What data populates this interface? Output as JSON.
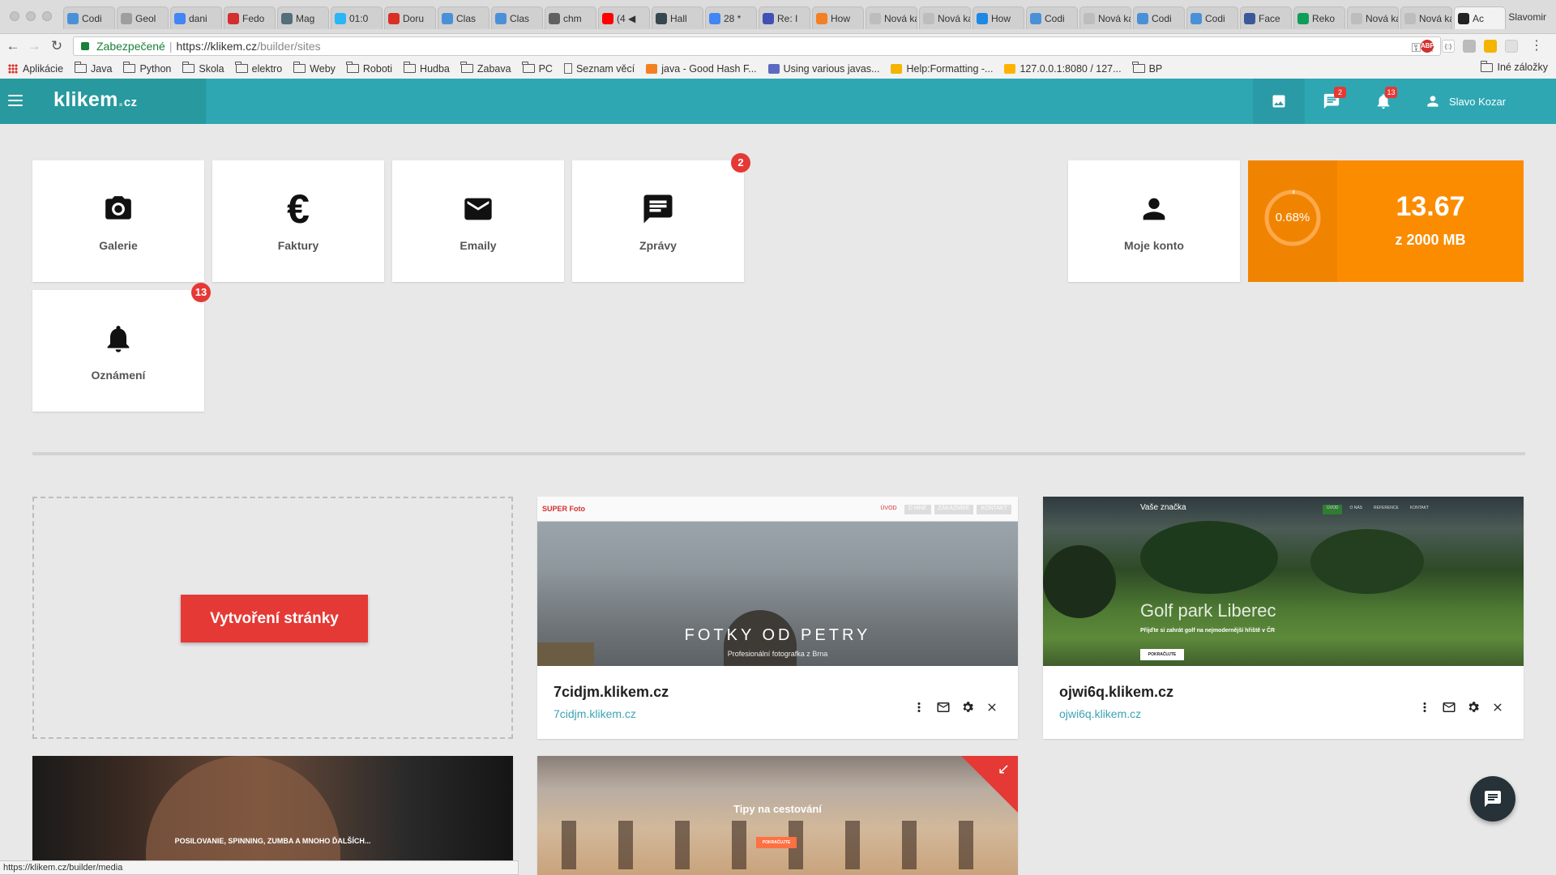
{
  "browser": {
    "tabs": [
      {
        "label": "Codi",
        "color": "#4a90d9"
      },
      {
        "label": "Geol",
        "color": "#9e9e9e"
      },
      {
        "label": "dani",
        "color": "#4285f4"
      },
      {
        "label": "Fedo",
        "color": "#d32f2f"
      },
      {
        "label": "Mag",
        "color": "#546e7a"
      },
      {
        "label": "01:0",
        "color": "#29b6f6"
      },
      {
        "label": "Doru",
        "color": "#d93025"
      },
      {
        "label": "Clas",
        "color": "#4a90d9"
      },
      {
        "label": "Clas",
        "color": "#4a90d9"
      },
      {
        "label": "chm",
        "color": "#616161"
      },
      {
        "label": "(4 ◀",
        "color": "#ff0000"
      },
      {
        "label": "Hall",
        "color": "#37474f"
      },
      {
        "label": "28 *",
        "color": "#4285f4"
      },
      {
        "label": "Re: I",
        "color": "#3f51b5"
      },
      {
        "label": "How",
        "color": "#f48024"
      },
      {
        "label": "Nová ka",
        "color": "#bdbdbd"
      },
      {
        "label": "Nová ka",
        "color": "#bdbdbd"
      },
      {
        "label": "How",
        "color": "#1e88e5"
      },
      {
        "label": "Codi",
        "color": "#4a90d9"
      },
      {
        "label": "Nová ka",
        "color": "#bdbdbd"
      },
      {
        "label": "Codi",
        "color": "#4a90d9"
      },
      {
        "label": "Codi",
        "color": "#4a90d9"
      },
      {
        "label": "Face",
        "color": "#3b5998"
      },
      {
        "label": "Reko",
        "color": "#0f9d58"
      },
      {
        "label": "Nová ka",
        "color": "#bdbdbd"
      },
      {
        "label": "Nová ka",
        "color": "#bdbdbd"
      },
      {
        "label": "Ac",
        "color": "#222222",
        "active": true
      }
    ],
    "profile_name": "Slavomir",
    "secure_label": "Zabezpečené",
    "url_host": "https://klikem.cz",
    "url_path": "/builder/sites",
    "bookmarks": [
      {
        "label": "Aplikácie",
        "icon": "apps-grid-icon"
      },
      {
        "label": "Java",
        "icon": "folder-icon"
      },
      {
        "label": "Python",
        "icon": "folder-icon"
      },
      {
        "label": "Skola",
        "icon": "folder-icon"
      },
      {
        "label": "elektro",
        "icon": "folder-icon"
      },
      {
        "label": "Weby",
        "icon": "folder-icon"
      },
      {
        "label": "Roboti",
        "icon": "folder-icon"
      },
      {
        "label": "Hudba",
        "icon": "folder-icon"
      },
      {
        "label": "Zabava",
        "icon": "folder-icon"
      },
      {
        "label": "PC",
        "icon": "folder-icon"
      },
      {
        "label": "Seznam věcí",
        "icon": "page-icon"
      },
      {
        "label": "java - Good Hash F...",
        "icon": "stackoverflow-icon"
      },
      {
        "label": "Using various javas...",
        "icon": "code-icon"
      },
      {
        "label": "Help:Formatting -...",
        "icon": "wiki-icon"
      },
      {
        "label": "127.0.0.1:8080 / 127...",
        "icon": "phpmyadmin-icon"
      },
      {
        "label": "BP",
        "icon": "folder-icon"
      }
    ],
    "other_bookmarks": "Iné záložky",
    "status_url": "https://klikem.cz/builder/media"
  },
  "app": {
    "logo_main": "klikem",
    "logo_tld": "cz",
    "messages_badge": "2",
    "notifications_badge": "13",
    "user_name": "Slavo Kozar",
    "accent_color": "#2ea7b3",
    "danger_color": "#e53935",
    "storage_color": "#fb8c00"
  },
  "tiles": {
    "gallery": "Galerie",
    "invoices": "Faktury",
    "emails": "Emaily",
    "messages": "Zprávy",
    "messages_badge": "2",
    "notifications": "Oznámení",
    "notifications_badge": "13",
    "account": "Moje konto"
  },
  "storage": {
    "percent_label": "0.68%",
    "percent_value": 0.68,
    "used": "13.67",
    "total": "z 2000 MB"
  },
  "sites": {
    "create_label": "Vytvoření stránky",
    "cards": [
      {
        "name": "7cidjm.klikem.cz",
        "url": "7cidjm.klikem.cz",
        "thumb_brand": "SUPER Foto",
        "thumb_nav": [
          "ÚVOD",
          "O MNE",
          "ZÁKAZNÍKÉ",
          "KONTAKT"
        ],
        "thumb_title": "FOTKY OD PETRY",
        "thumb_subtitle": "Profesionální fotografka z Brna"
      },
      {
        "name": "ojwi6q.klikem.cz",
        "url": "ojwi6q.klikem.cz",
        "thumb_brand": "Vaše značka",
        "thumb_nav": [
          "ÚVOD",
          "O NÁS",
          "REFERENCE",
          "KONTAKT"
        ],
        "thumb_title": "Golf park Liberec",
        "thumb_subtitle": "Přijďte si zahrát golf na nejmodernější hřiště v ČR",
        "thumb_button": "POKRAČUJTE"
      },
      {
        "thumb_title": "POSILOVANIE, SPINNING, ZUMBA A MNOHO ĎALŠÍCH..."
      },
      {
        "thumb_title": "Tipy na cestování",
        "thumb_button": "POKRAČUJTE"
      }
    ]
  }
}
